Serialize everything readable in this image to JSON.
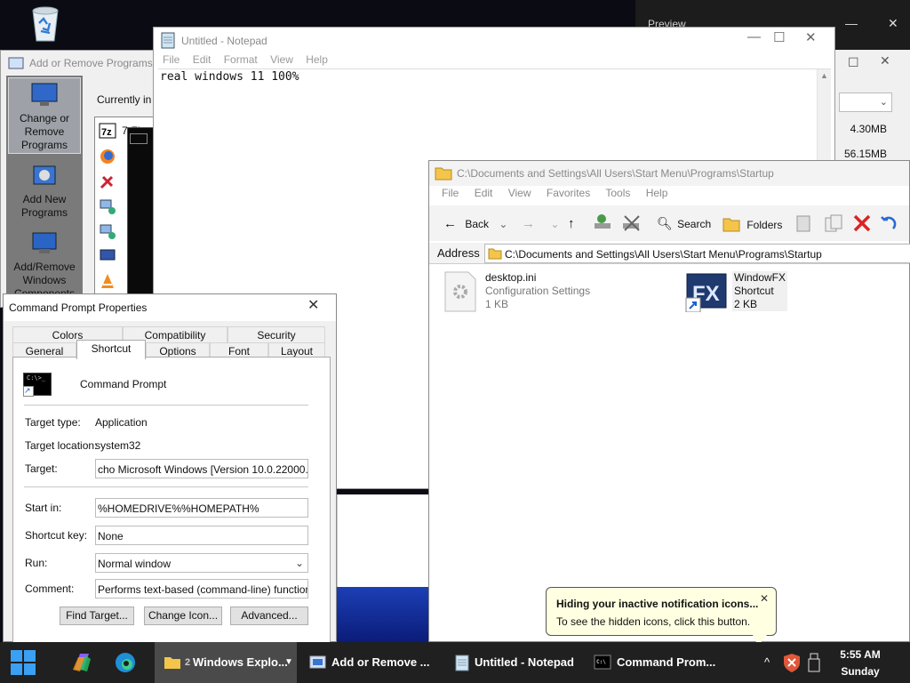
{
  "desktop": {
    "recycle_bin_icon": "recycle-bin-icon",
    "bg_window_title": "Preview"
  },
  "add_remove": {
    "title": "Add or Remove Programs",
    "sidebar": [
      {
        "label": "Change or Remove Programs",
        "lines": [
          "Change or",
          "Remove",
          "Programs"
        ],
        "icon": "monitor-box-icon"
      },
      {
        "label": "Add New Programs",
        "lines": [
          "Add New",
          "Programs"
        ],
        "icon": "cd-box-icon"
      },
      {
        "label": "Add/Remove Windows Components",
        "lines": [
          "Add/Remove",
          "Windows",
          "Components"
        ],
        "icon": "windows-components-icon"
      }
    ],
    "currently_label": "Currently in",
    "row1_text": "7-Zip",
    "program_icons": [
      "7zip-icon",
      "firefox-icon",
      "tools-icon",
      "network-icon",
      "network-icon",
      "monitor-icon",
      "vlc-icon"
    ]
  },
  "sizes_window": {
    "sizes": [
      "4.30MB",
      "56.15MB"
    ]
  },
  "notepad": {
    "title": "Untitled - Notepad",
    "menu": [
      "File",
      "Edit",
      "Format",
      "View",
      "Help"
    ],
    "content": "real windows 11 100%"
  },
  "explorer": {
    "title": "C:\\Documents and Settings\\All Users\\Start Menu\\Programs\\Startup",
    "menu": [
      "File",
      "Edit",
      "View",
      "Favorites",
      "Tools",
      "Help"
    ],
    "toolbar": {
      "back": "Back",
      "search": "Search",
      "folders": "Folders"
    },
    "address_label": "Address",
    "address": "C:\\Documents and Settings\\All Users\\Start Menu\\Programs\\Startup",
    "files": [
      {
        "name": "desktop.ini",
        "type": "Configuration Settings",
        "size": "1 KB",
        "icon": "settings-file-icon"
      },
      {
        "name": "WindowFX",
        "type": "Shortcut",
        "size": "2 KB",
        "icon": "windowfx-icon"
      }
    ]
  },
  "properties": {
    "title": "Command Prompt Properties",
    "tabs_top": [
      "Colors",
      "Compatibility",
      "Security"
    ],
    "tabs_bottom": [
      "General",
      "Shortcut",
      "Options",
      "Font",
      "Layout"
    ],
    "active_tab": "Shortcut",
    "name": "Command Prompt",
    "target_type_label": "Target type:",
    "target_type": "Application",
    "target_location_label": "Target location:",
    "target_location": "system32",
    "target_label": "Target:",
    "target": "cho Microsoft Windows [Version 10.0.22000.100",
    "start_in_label": "Start in:",
    "start_in": "%HOMEDRIVE%%HOMEPATH%",
    "shortcut_key_label": "Shortcut key:",
    "shortcut_key": "None",
    "run_label": "Run:",
    "run": "Normal window",
    "comment_label": "Comment:",
    "comment": "Performs text-based (command-line) functions.",
    "buttons": {
      "find": "Find Target...",
      "change": "Change Icon...",
      "advanced": "Advanced..."
    }
  },
  "balloon": {
    "heading": "Hiding your inactive notification icons...",
    "body": "To see the hidden icons, click this button."
  },
  "taskbar": {
    "items": [
      {
        "label": "Windows Explo...",
        "count": "2",
        "icon": "folder-icon"
      },
      {
        "label": "Add or Remove ...",
        "icon": "programs-icon"
      },
      {
        "label": "Untitled - Notepad",
        "icon": "notepad-icon"
      },
      {
        "label": "Command Prom...",
        "icon": "cmd-icon"
      }
    ],
    "time": "5:55 AM",
    "day": "Sunday"
  },
  "colors": {
    "accent": "#1a73e8",
    "taskbar": "#202020",
    "balloon": "#ffffe1"
  }
}
